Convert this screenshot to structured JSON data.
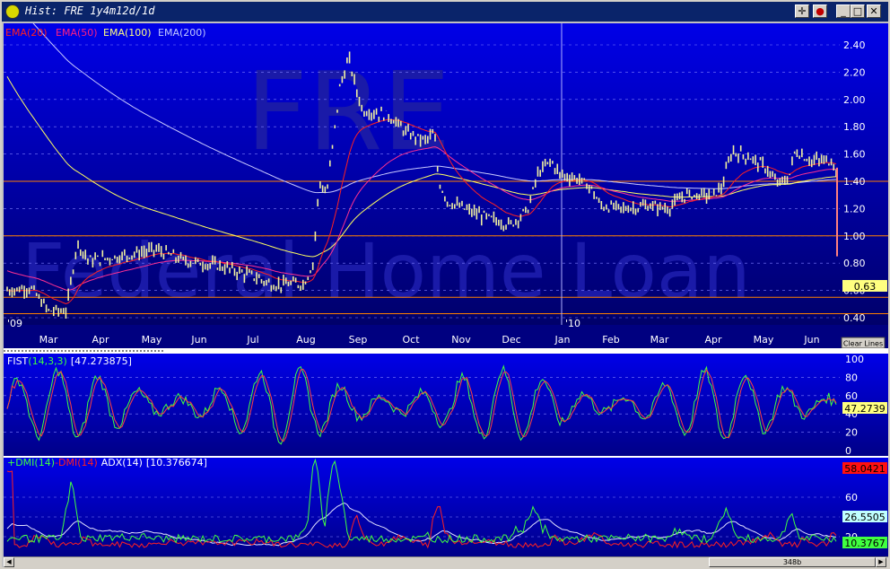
{
  "window": {
    "title": "Hist: FRE 1y4m12d/1d",
    "buttons": {
      "crosshair": "✛",
      "record": "●",
      "minimize": "_",
      "maximize": "□",
      "close": "✕"
    }
  },
  "watermark": {
    "symbol": "FRE",
    "name": "Federal Home Loan"
  },
  "price_panel": {
    "legend": [
      {
        "label": "EMA(20)",
        "color": "#ff2020"
      },
      {
        "label": "EMA(50)",
        "color": "#ff2080"
      },
      {
        "label": "EMA(100)",
        "color": "#ffff80"
      },
      {
        "label": "EMA(200)",
        "color": "#c0c8ff"
      }
    ],
    "y_ticks": [
      "2.40",
      "2.20",
      "2.00",
      "1.80",
      "1.60",
      "1.40",
      "1.20",
      "1.00",
      "0.80",
      "0.60",
      "0.40"
    ],
    "last_price": "0.63",
    "clear_lines": "Clear Lines",
    "x_labels": [
      "'09",
      "Mar",
      "Apr",
      "May",
      "Jun",
      "Jul",
      "Aug",
      "Sep",
      "Oct",
      "Nov",
      "Dec",
      "'10",
      "Jan",
      "Feb",
      "Mar",
      "Apr",
      "May",
      "Jun"
    ],
    "horizontal_lines": [
      1.4,
      1.0,
      0.55,
      0.43
    ]
  },
  "fist_panel": {
    "label_name": "FIST",
    "label_params": "(14,3,3)",
    "label_value": "[47.273875]",
    "y_ticks": [
      "100",
      "80",
      "60",
      "40",
      "20",
      "0"
    ],
    "last_value": "47.2739"
  },
  "dmi_panel": {
    "plus_label": "+DMI(14)",
    "minus_label": "-DMI(14)",
    "adx_label": "ADX(14)",
    "adx_value": "[10.376674]",
    "y_ticks": [
      "60",
      "40",
      "20"
    ],
    "minus_last": "58.0421",
    "adx_last": "26.5505",
    "plus_last": "10.3767"
  },
  "scrollbar": {
    "thumb_label": "348b",
    "left_arrow": "◀",
    "right_arrow": "▶"
  },
  "chart_data": {
    "type": "line",
    "price_monthly_approx": [
      {
        "month": "Mar 2009",
        "close": 0.5
      },
      {
        "month": "Apr 2009",
        "close": 0.8
      },
      {
        "month": "May 2009",
        "close": 0.82
      },
      {
        "month": "Jun 2009",
        "close": 0.78
      },
      {
        "month": "Jul 2009",
        "close": 0.66
      },
      {
        "month": "Aug 2009",
        "close": 1.3
      },
      {
        "month": "Sep 2009",
        "close": 2.05
      },
      {
        "month": "Oct 2009",
        "close": 1.8
      },
      {
        "month": "Nov 2009",
        "close": 1.12
      },
      {
        "month": "Dec 2009",
        "close": 1.1
      },
      {
        "month": "Jan 2010",
        "close": 1.45
      },
      {
        "month": "Feb 2010",
        "close": 1.18
      },
      {
        "month": "Mar 2010",
        "close": 1.22
      },
      {
        "month": "Apr 2010",
        "close": 1.3
      },
      {
        "month": "May 2010",
        "close": 1.5
      },
      {
        "month": "Jun 2010",
        "close": 1.52
      }
    ],
    "ylim": [
      0.35,
      2.55
    ]
  }
}
